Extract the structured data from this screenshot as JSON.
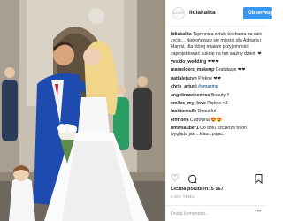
{
  "header": {
    "avatar_text": "LOGO",
    "username": "lidiakalita",
    "follow_label": "Obserwuj"
  },
  "comments": [
    {
      "user": "lidiakalita",
      "text": "Tajemnica sztuki kochania na całe życie... Niekończący się miłości dla Adriana i Marysi, dla której miałam przyjemność zaprojektować suknię na ten ważny dzień! ❤"
    },
    {
      "user": "yesido_wedding",
      "text": "❤❤❤"
    },
    {
      "user": "mamelcerz_makeup",
      "text": "Gratulacje ❤❤"
    },
    {
      "user": "nattalejszyn",
      "text": "Piękne ❤❤"
    },
    {
      "user": "chris_artuni",
      "text": "#amazing"
    },
    {
      "user": "angelinawinemiss",
      "text": "Beauty !!"
    },
    {
      "user": "smiles_my_love",
      "text": "Piękne <3"
    },
    {
      "user": "fashionrulle",
      "text": "Beautiful"
    },
    {
      "user": "elffriona",
      "text": "Cudowna 😍😍"
    },
    {
      "user": "bmwsauber1",
      "text": "Do bólu szczerze to on wygląda jak ...klaun,pajac."
    }
  ],
  "actions": {
    "like_icon": "heart-icon",
    "comment_icon": "comment-icon",
    "bookmark_icon": "bookmark-icon"
  },
  "likes_text": "Liczba polubień: 5 567",
  "date_text": "5 DNI TEMU",
  "add_comment_placeholder": "Dodaj komentarz...",
  "more_label": "•••",
  "colors": {
    "accent": "#3897f0",
    "link": "#003569",
    "muted": "#999999",
    "text": "#262626"
  }
}
